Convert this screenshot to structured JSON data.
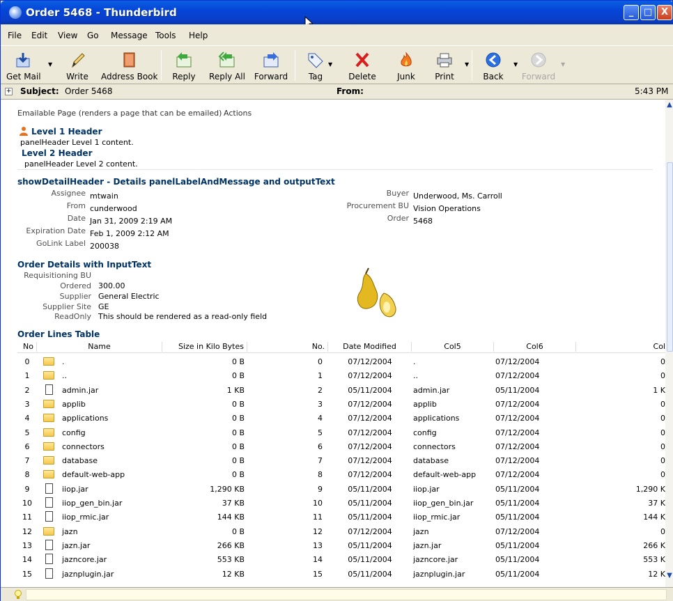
{
  "window": {
    "title": "Order 5468 - Thunderbird",
    "min": "_",
    "max": "□",
    "close": "X"
  },
  "menu": [
    "File",
    "Edit",
    "View",
    "Go",
    "Message",
    "Tools",
    "Help"
  ],
  "toolbar": {
    "get_mail": "Get Mail",
    "write": "Write",
    "address_book": "Address Book",
    "reply": "Reply",
    "reply_all": "Reply All",
    "forward": "Forward",
    "tag": "Tag",
    "delete": "Delete",
    "junk": "Junk",
    "print": "Print",
    "back": "Back",
    "forward_nav": "Forward"
  },
  "header": {
    "subject_label": "Subject:",
    "subject": "Order 5468",
    "from_label": "From:",
    "time": "5:43 PM"
  },
  "page": {
    "emailable": "Emailable Page (renders a page that can be emailed)",
    "actions": "Actions",
    "level1": "Level 1 Header",
    "level1_content": "panelHeader Level 1 content.",
    "level2": "Level 2 Header",
    "level2_content": "panelHeader Level 2 content.",
    "detail_header": "showDetailHeader - Details panelLabelAndMessage and outputText",
    "assignee_l": "Assignee",
    "assignee": "mtwain",
    "from_l": "From",
    "from": "cunderwood",
    "date_l": "Date",
    "date": "Jan 31, 2009 2:19 AM",
    "exp_l": "Expiration Date",
    "exp": "Feb 1, 2009 2:12 AM",
    "golink_l": "GoLink Label",
    "golink": "200038",
    "buyer_l": "Buyer",
    "buyer": "Underwood, Ms. Carroll",
    "pbu_l": "Procurement BU",
    "pbu": "Vision Operations",
    "order_l": "Order",
    "order": "5468",
    "od_header": "Order Details with InputText",
    "reqbu_l": "Requisitioning BU",
    "ordered_l": "Ordered",
    "ordered": "300.00",
    "supplier_l": "Supplier",
    "supplier": "General Electric",
    "site_l": "Supplier Site",
    "site": "GE",
    "ro_l": "ReadOnly",
    "ro": "This should be rendered as a read-only field",
    "lines_header": "Order Lines Table"
  },
  "table": {
    "columns": [
      "No",
      "Name",
      "Size in Kilo Bytes",
      "No.",
      "Date Modified",
      "Col5",
      "Col6",
      "Col"
    ],
    "rows": [
      {
        "no": "0",
        "type": "folder",
        "name": ".",
        "size": "0 B",
        "no2": "0",
        "date": "07/12/2004",
        "col5": ".",
        "col6": "07/12/2004",
        "col7": "0"
      },
      {
        "no": "1",
        "type": "folder",
        "name": "..",
        "size": "0 B",
        "no2": "1",
        "date": "07/12/2004",
        "col5": "..",
        "col6": "07/12/2004",
        "col7": "0"
      },
      {
        "no": "2",
        "type": "file",
        "name": "admin.jar",
        "size": "1 KB",
        "no2": "2",
        "date": "05/11/2004",
        "col5": "admin.jar",
        "col6": "05/11/2004",
        "col7": "1 K"
      },
      {
        "no": "3",
        "type": "folder",
        "name": "applib",
        "size": "0 B",
        "no2": "3",
        "date": "07/12/2004",
        "col5": "applib",
        "col6": "07/12/2004",
        "col7": "0"
      },
      {
        "no": "4",
        "type": "folder",
        "name": "applications",
        "size": "0 B",
        "no2": "4",
        "date": "07/12/2004",
        "col5": "applications",
        "col6": "07/12/2004",
        "col7": "0"
      },
      {
        "no": "5",
        "type": "folder",
        "name": "config",
        "size": "0 B",
        "no2": "5",
        "date": "07/12/2004",
        "col5": "config",
        "col6": "07/12/2004",
        "col7": "0"
      },
      {
        "no": "6",
        "type": "folder",
        "name": "connectors",
        "size": "0 B",
        "no2": "6",
        "date": "07/12/2004",
        "col5": "connectors",
        "col6": "07/12/2004",
        "col7": "0"
      },
      {
        "no": "7",
        "type": "folder",
        "name": "database",
        "size": "0 B",
        "no2": "7",
        "date": "07/12/2004",
        "col5": "database",
        "col6": "07/12/2004",
        "col7": "0"
      },
      {
        "no": "8",
        "type": "folder",
        "name": "default-web-app",
        "size": "0 B",
        "no2": "8",
        "date": "07/12/2004",
        "col5": "default-web-app",
        "col6": "07/12/2004",
        "col7": "0"
      },
      {
        "no": "9",
        "type": "file",
        "name": "iiop.jar",
        "size": "1,290 KB",
        "no2": "9",
        "date": "05/11/2004",
        "col5": "iiop.jar",
        "col6": "05/11/2004",
        "col7": "1,290 K"
      },
      {
        "no": "10",
        "type": "file",
        "name": "iiop_gen_bin.jar",
        "size": "37 KB",
        "no2": "10",
        "date": "05/11/2004",
        "col5": "iiop_gen_bin.jar",
        "col6": "05/11/2004",
        "col7": "37 K"
      },
      {
        "no": "11",
        "type": "file",
        "name": "iiop_rmic.jar",
        "size": "144 KB",
        "no2": "11",
        "date": "05/11/2004",
        "col5": "iiop_rmic.jar",
        "col6": "05/11/2004",
        "col7": "144 K"
      },
      {
        "no": "12",
        "type": "folder",
        "name": "jazn",
        "size": "0 B",
        "no2": "12",
        "date": "07/12/2004",
        "col5": "jazn",
        "col6": "07/12/2004",
        "col7": "0"
      },
      {
        "no": "13",
        "type": "file",
        "name": "jazn.jar",
        "size": "266 KB",
        "no2": "13",
        "date": "05/11/2004",
        "col5": "jazn.jar",
        "col6": "05/11/2004",
        "col7": "266 K"
      },
      {
        "no": "14",
        "type": "file",
        "name": "jazncore.jar",
        "size": "553 KB",
        "no2": "14",
        "date": "05/11/2004",
        "col5": "jazncore.jar",
        "col6": "05/11/2004",
        "col7": "553 K"
      },
      {
        "no": "15",
        "type": "file",
        "name": "jaznplugin.jar",
        "size": "12 KB",
        "no2": "15",
        "date": "05/11/2004",
        "col5": "jaznplugin.jar",
        "col6": "05/11/2004",
        "col7": "12 K"
      }
    ]
  },
  "colors": {
    "title_blue": "#0545D8",
    "header_text": "#003366"
  }
}
